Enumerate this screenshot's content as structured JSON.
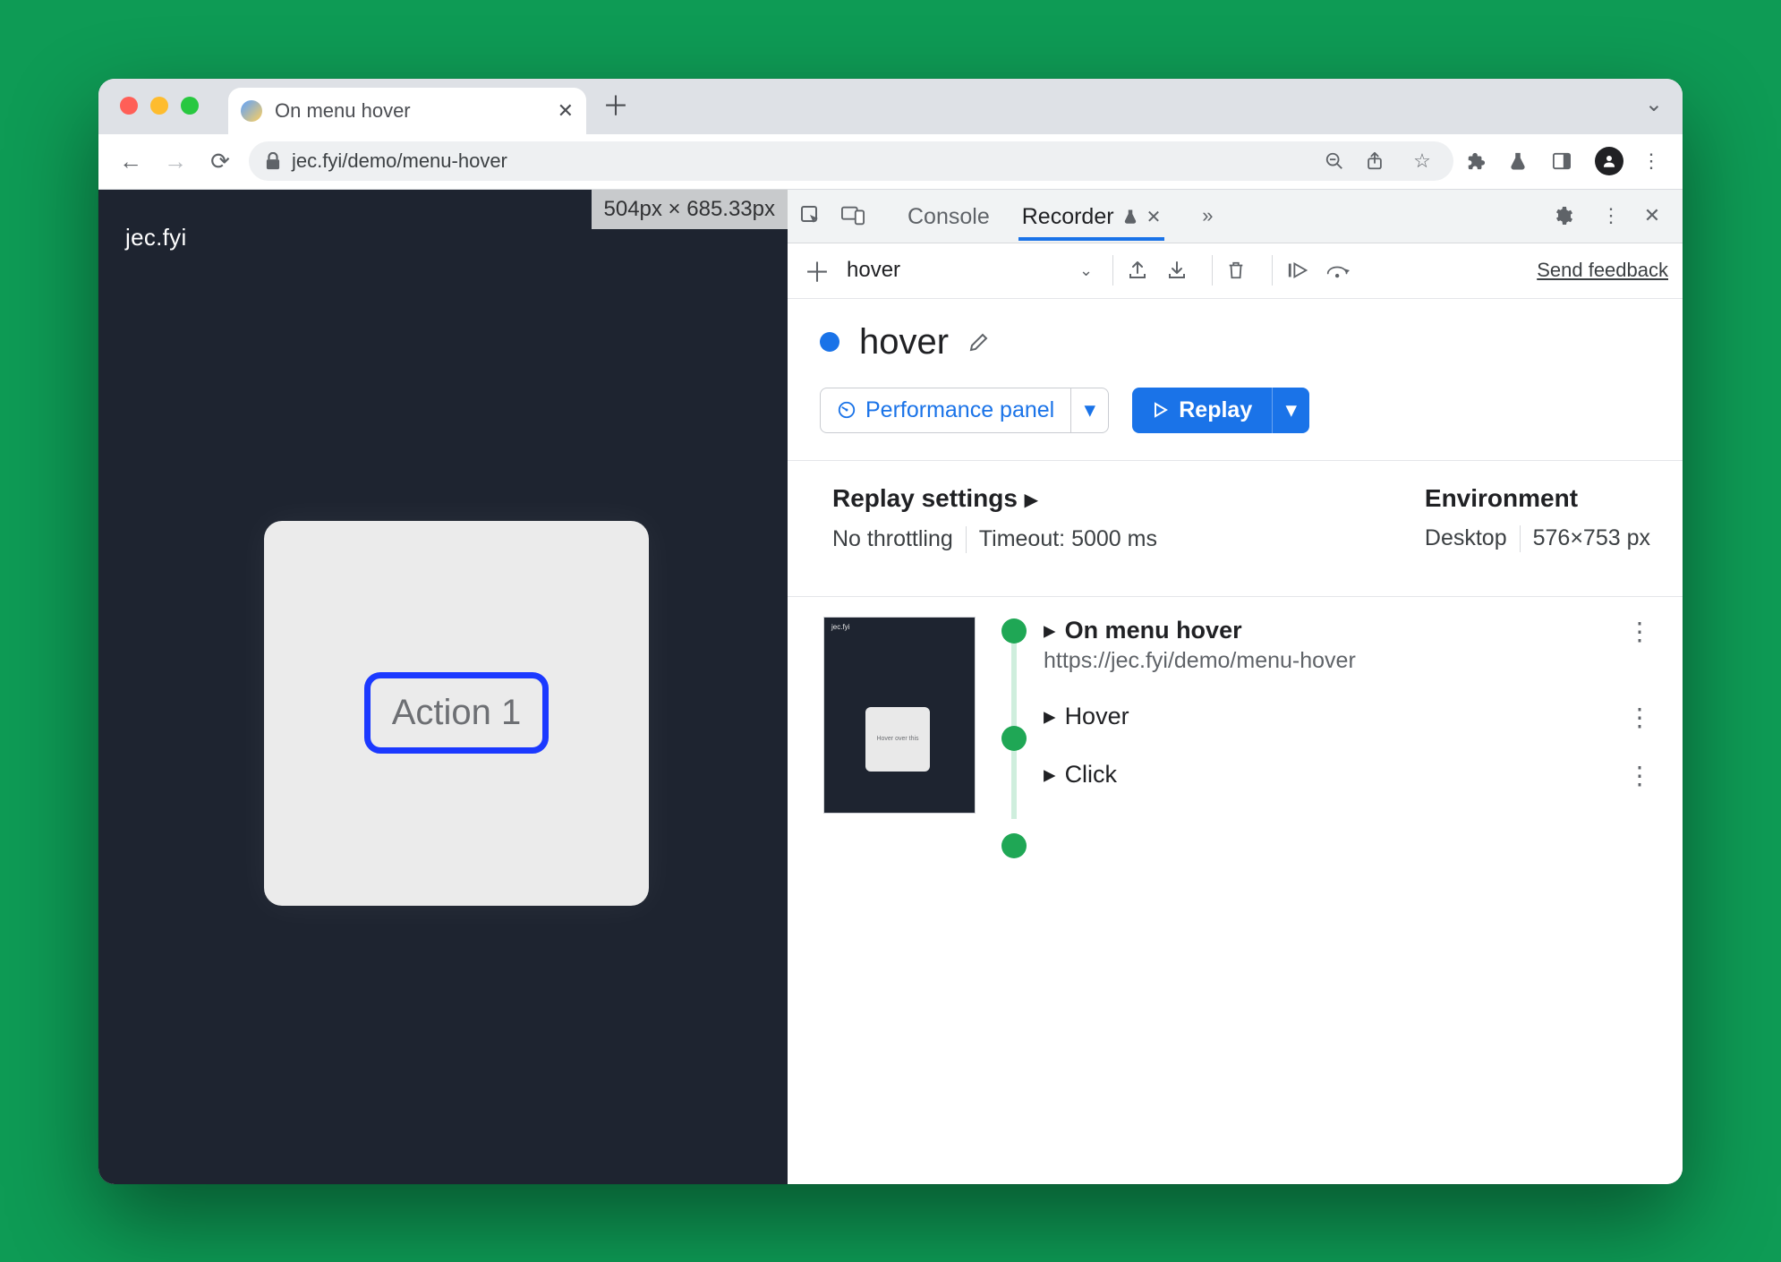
{
  "browser": {
    "tab_title": "On menu hover",
    "url": "jec.fyi/demo/menu-hover"
  },
  "page": {
    "brand": "jec.fyi",
    "dimension_label": "504px × 685.33px",
    "card_button": "Action 1"
  },
  "devtools": {
    "tabs": {
      "console": "Console",
      "recorder": "Recorder"
    },
    "toolbar": {
      "recording_name": "hover",
      "send_feedback": "Send feedback"
    },
    "recording": {
      "title": "hover",
      "perf_button": "Performance panel",
      "replay_button": "Replay"
    },
    "settings": {
      "replay_heading": "Replay settings",
      "env_heading": "Environment",
      "throttling": "No throttling",
      "timeout": "Timeout: 5000 ms",
      "device": "Desktop",
      "viewport": "576×753 px"
    },
    "steps": {
      "s1_title": "On menu hover",
      "s1_url": "https://jec.fyi/demo/menu-hover",
      "s2_title": "Hover",
      "s3_title": "Click"
    }
  }
}
